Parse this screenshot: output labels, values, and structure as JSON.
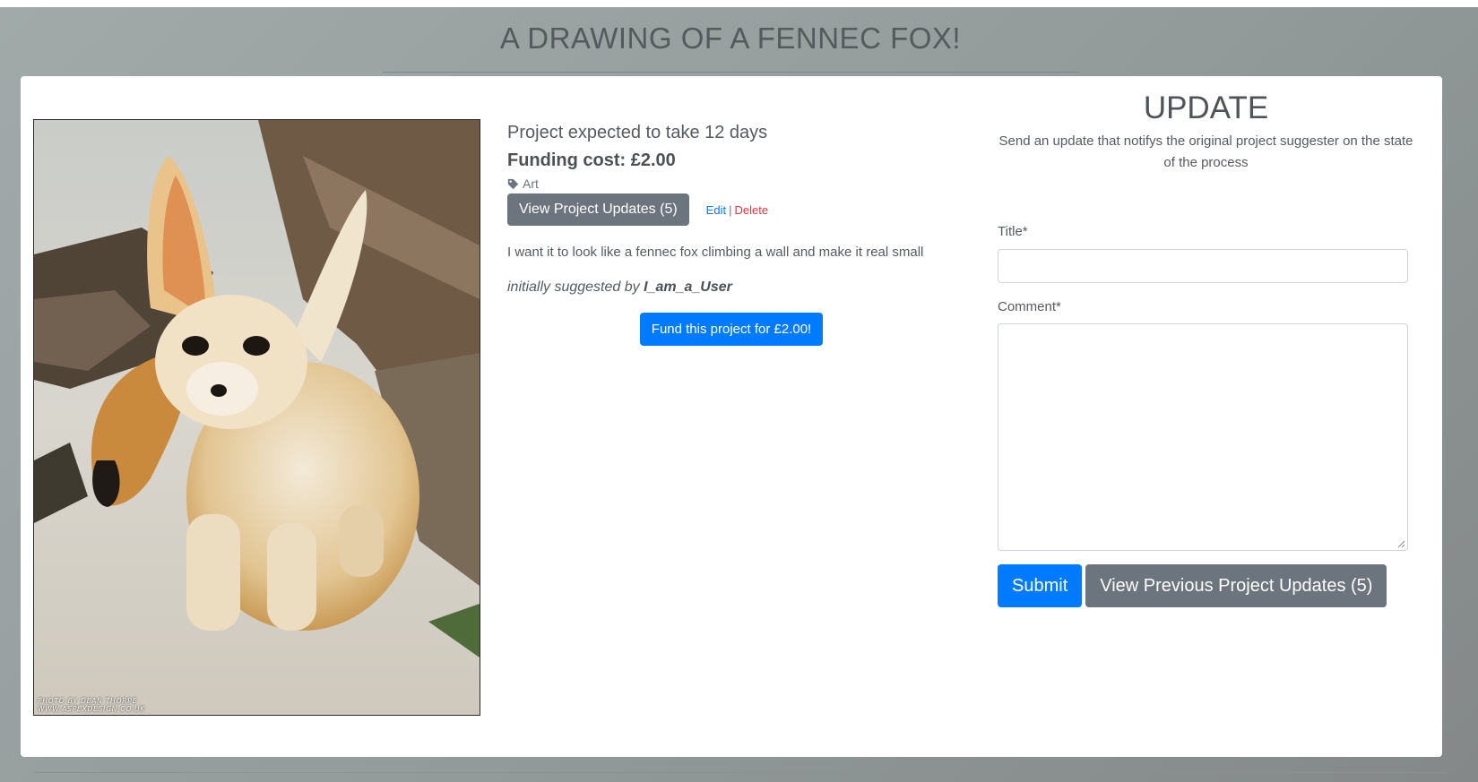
{
  "page": {
    "title": "A DRAWING OF A FENNEC FOX!"
  },
  "photo": {
    "alt": "fennec fox photo",
    "watermark_line1": "PHOTO BY DEAN THORPE",
    "watermark_line2": "WWW.ASPEXDESIGN.CO.UK"
  },
  "project": {
    "duration": "Project expected to take 12 days",
    "cost": "Funding cost: £2.00",
    "tag": "Art",
    "view_updates_label": "View Project Updates (5)",
    "edit_label": "Edit",
    "separator": "|",
    "delete_label": "Delete",
    "description": "I want it to look like a fennec fox climbing a wall and make it real small",
    "suggested_prefix": "initially suggested by",
    "suggested_user": "I_am_a_User",
    "fund_label": "Fund this project for £2.00!"
  },
  "update_form": {
    "heading": "UPDATE",
    "subtitle": "Send an update that notifys the original project suggester on the state of the process",
    "title_label": "Title*",
    "title_value": "",
    "comment_label": "Comment*",
    "comment_value": "",
    "submit_label": "Submit",
    "previous_label": "View Previous Project Updates (5)"
  },
  "colors": {
    "primary": "#007bff",
    "secondary": "#6c757d",
    "danger": "#dc3545"
  },
  "icons": {
    "tag": "tag-icon"
  }
}
